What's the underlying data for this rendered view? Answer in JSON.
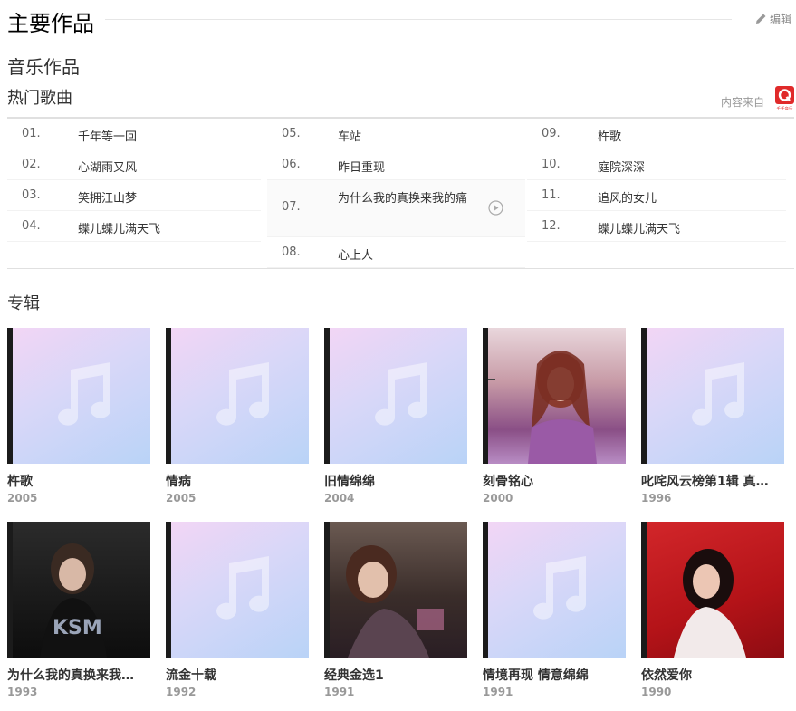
{
  "header": {
    "title": "主要作品",
    "edit_label": "编辑"
  },
  "music_works": "音乐作品",
  "hot_songs": {
    "title": "热门歌曲",
    "source_label": "内容来自",
    "source_logo_text": "千千音乐",
    "columns": [
      [
        {
          "num": "01.",
          "name": "千年等一回"
        },
        {
          "num": "02.",
          "name": "心湖雨又风"
        },
        {
          "num": "03.",
          "name": "笑拥江山梦"
        },
        {
          "num": "04.",
          "name": "蝶儿蝶儿满天飞"
        }
      ],
      [
        {
          "num": "05.",
          "name": "车站"
        },
        {
          "num": "06.",
          "name": "昨日重现"
        },
        {
          "num": "07.",
          "name": "为什么我的真换来我的痛"
        },
        {
          "num": "08.",
          "name": "心上人"
        }
      ],
      [
        {
          "num": "09.",
          "name": "杵歌"
        },
        {
          "num": "10.",
          "name": "庭院深深"
        },
        {
          "num": "11.",
          "name": "追风的女儿"
        },
        {
          "num": "12.",
          "name": "蝶儿蝶儿满天飞"
        }
      ]
    ]
  },
  "albums": {
    "title": "专辑",
    "items": [
      {
        "title": "杵歌",
        "year": "2005"
      },
      {
        "title": "情病",
        "year": "2005"
      },
      {
        "title": "旧情绵绵",
        "year": "2004"
      },
      {
        "title": "刻骨铭心",
        "year": "2000"
      },
      {
        "title": "叱咤风云榜第1辑 真…",
        "year": "1996"
      },
      {
        "title": "为什么我的真换来我…",
        "year": "1993"
      },
      {
        "title": "流金十载",
        "year": "1992"
      },
      {
        "title": "经典金选1",
        "year": "1991"
      },
      {
        "title": "情境再现 情意绵绵",
        "year": "1991"
      },
      {
        "title": "依然爱你",
        "year": "1990"
      }
    ]
  }
}
